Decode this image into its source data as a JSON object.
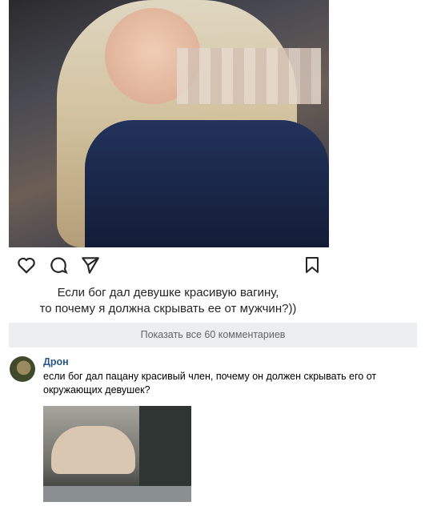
{
  "post": {
    "caption_line1": "Если бог дал девушке красивую вагину,",
    "caption_line2": "то почему я должна скрывать ее от мужчин?))",
    "actions": {
      "like_icon": "heart-icon",
      "comment_icon": "comment-icon",
      "share_icon": "share-icon",
      "save_icon": "bookmark-icon"
    }
  },
  "comments_bar": {
    "show_all_label": "Показать все 60 комментариев"
  },
  "comment": {
    "author": "Дрон",
    "text": "если бог дал пацану красивый член, почему он должен скрывать его от окружающих девушек?"
  },
  "colors": {
    "link": "#2a5885",
    "bar_bg": "#edeef0",
    "bar_text": "#656565"
  }
}
